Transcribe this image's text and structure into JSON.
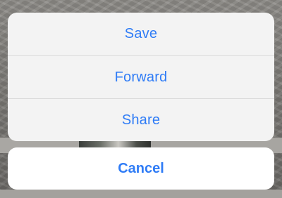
{
  "action_sheet": {
    "items": [
      {
        "label": "Save"
      },
      {
        "label": "Forward"
      },
      {
        "label": "Share"
      }
    ],
    "cancel_label": "Cancel"
  },
  "colors": {
    "action_text": "#2f7cf6",
    "sheet_bg": "#f3f3f3",
    "cancel_bg": "#ffffff"
  }
}
